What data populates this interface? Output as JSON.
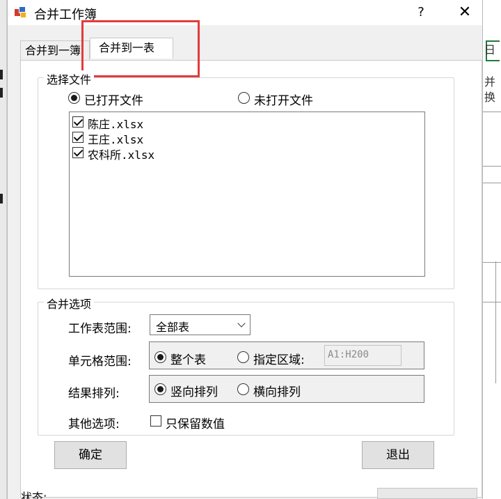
{
  "dialog": {
    "title": "合并工作簿",
    "help_label": "?",
    "close_label": "✕",
    "icon": "app-icon"
  },
  "tabs": [
    {
      "label": "合并到一簿",
      "selected": false
    },
    {
      "label": "合并到一表",
      "selected": true
    }
  ],
  "file_group": {
    "legend": "选择文件",
    "radio_opened": {
      "label": "已打开文件",
      "checked": true
    },
    "radio_unopened": {
      "label": "未打开文件",
      "checked": false
    },
    "files": [
      {
        "name": "陈庄.xlsx",
        "checked": true
      },
      {
        "name": "王庄.xlsx",
        "checked": true
      },
      {
        "name": "农科所.xlsx",
        "checked": true
      }
    ]
  },
  "options_group": {
    "legend": "合并选项",
    "sheet_range": {
      "label": "工作表范围:",
      "value": "全部表"
    },
    "cell_range": {
      "label": "单元格范围:",
      "whole": {
        "label": "整个表",
        "checked": true
      },
      "specified": {
        "label": "指定区域:",
        "checked": false
      },
      "placeholder": "A1:H200"
    },
    "result_order": {
      "label": "结果排列:",
      "vertical": {
        "label": "竖向排列",
        "checked": true
      },
      "horizontal": {
        "label": "横向排列",
        "checked": false
      }
    },
    "other": {
      "label": "其他选项:",
      "values_only": {
        "label": "只保留数值",
        "checked": false
      }
    }
  },
  "buttons": {
    "ok": "确定",
    "exit": "退出"
  },
  "status": {
    "label": "状态:"
  },
  "background": {
    "chars": [
      "日",
      "并",
      "换"
    ]
  },
  "colors": {
    "highlight": "#e23b3b",
    "window_bg": "#f0f0f0",
    "panel_bg": "#ffffff"
  }
}
